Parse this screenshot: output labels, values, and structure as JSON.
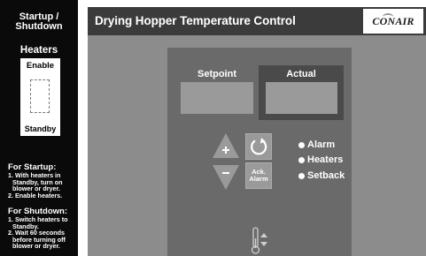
{
  "sidebar": {
    "title_line1": "Startup /",
    "title_line2": "Shutdown",
    "heaters_label": "Heaters",
    "switch_top_label": "Enable",
    "switch_bottom_label": "Standby",
    "startup": {
      "heading": "For Startup:",
      "lines": [
        "1. With heaters in",
        "Standby, turn on",
        "blower or dryer.",
        "2. Enable heaters."
      ]
    },
    "shutdown": {
      "heading": "For Shutdown:",
      "lines": [
        "1. Switch heaters to",
        "Standby.",
        "2. Wait 60 seconds",
        "before turning off",
        "blower or dryer."
      ]
    }
  },
  "window": {
    "title": "Drying Hopper Temperature Control",
    "logo_text": "CONAIR"
  },
  "panel": {
    "setpoint_label": "Setpoint",
    "actual_label": "Actual",
    "setpoint_value": "",
    "actual_value": "",
    "ack_line1": "Ack.",
    "ack_line2": "Alarm",
    "indicators": [
      {
        "label": "Alarm"
      },
      {
        "label": "Heaters"
      },
      {
        "label": "Setback"
      }
    ]
  },
  "colors": {
    "sidebar_bg": "#0a0a0a",
    "window_bg": "#8c8c8c",
    "titlebar_bg": "#3b3b3b",
    "panel_bg": "#6a6a6a",
    "display_bg": "#9a9a9a",
    "indicator_dot": "#ffffff"
  },
  "icons": {
    "increase": "up-triangle-plus-icon",
    "decrease": "down-triangle-minus-icon",
    "reset": "circular-arrow-icon",
    "thermometer": "thermometer-updown-icon"
  }
}
